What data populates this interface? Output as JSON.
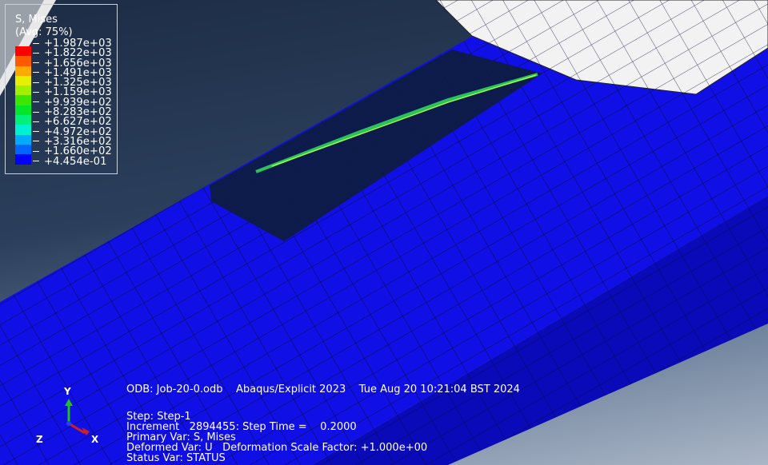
{
  "legend": {
    "title": "S, Mises",
    "subtitle": "(Avg: 75%)",
    "values": [
      "+1.987e+03",
      "+1.822e+03",
      "+1.656e+03",
      "+1.491e+03",
      "+1.325e+03",
      "+1.159e+03",
      "+9.939e+02",
      "+8.283e+02",
      "+6.627e+02",
      "+4.972e+02",
      "+3.316e+02",
      "+1.660e+02",
      "+4.454e-01"
    ],
    "colors": [
      "#ff0000",
      "#ff5a00",
      "#ffaa00",
      "#e6f000",
      "#a0f000",
      "#3ce600",
      "#00e628",
      "#00f078",
      "#00f0d2",
      "#00aaff",
      "#0064ff",
      "#0000ff"
    ]
  },
  "info": {
    "header": "ODB: Job-20-0.odb    Abaqus/Explicit 2023    Tue Aug 20 10:21:04 BST 2024",
    "step": "Step: Step-1",
    "increment": "Increment   2894455: Step Time =    0.2000",
    "primary_var": "Primary Var: S, Mises",
    "deformed_var": "Deformed Var: U   Deformation Scale Factor: +1.000e+00",
    "status_var": "Status Var: STATUS"
  },
  "triad": {
    "y": "Y",
    "z": "Z",
    "x": "X"
  }
}
